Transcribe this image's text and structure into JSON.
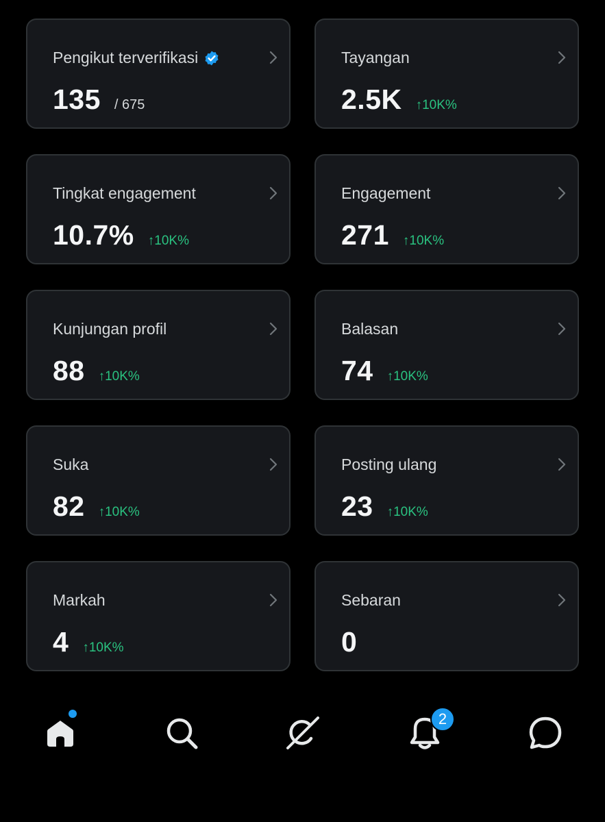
{
  "colors": {
    "background": "#000000",
    "card_bg": "#16181c",
    "card_border": "#2f3336",
    "positive": "#2ac280",
    "accent": "#1d9bf0"
  },
  "cards": [
    {
      "title": "Pengikut terverifikasi",
      "value": "135",
      "sub": "/ 675",
      "change": "",
      "verified": true
    },
    {
      "title": "Tayangan",
      "value": "2.5K",
      "sub": "",
      "change": "10K%"
    },
    {
      "title": "Tingkat engagement",
      "value": "10.7%",
      "sub": "",
      "change": "10K%"
    },
    {
      "title": "Engagement",
      "value": "271",
      "sub": "",
      "change": "10K%"
    },
    {
      "title": "Kunjungan profil",
      "value": "88",
      "sub": "",
      "change": "10K%"
    },
    {
      "title": "Balasan",
      "value": "74",
      "sub": "",
      "change": "10K%"
    },
    {
      "title": "Suka",
      "value": "82",
      "sub": "",
      "change": "10K%"
    },
    {
      "title": "Posting ulang",
      "value": "23",
      "sub": "",
      "change": "10K%"
    },
    {
      "title": "Markah",
      "value": "4",
      "sub": "",
      "change": "10K%"
    },
    {
      "title": "Sebaran",
      "value": "0",
      "sub": "",
      "change": ""
    }
  ],
  "icons": {
    "verified": "verified-badge-icon",
    "chevron": "chevron-right-icon",
    "change_arrow": "arrow-up-icon"
  },
  "change_arrow": "↑",
  "nav": {
    "items": [
      "home-icon",
      "search-icon",
      "grok-icon",
      "bell-icon",
      "chat-icon"
    ],
    "notifications_badge": "2"
  }
}
